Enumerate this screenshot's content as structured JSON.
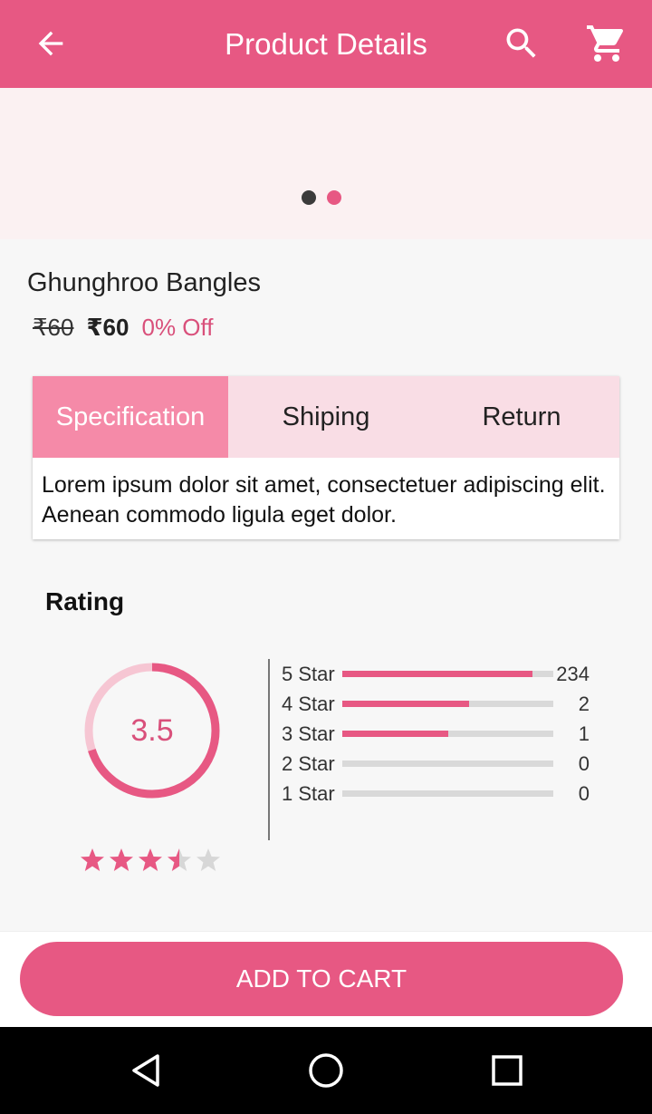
{
  "appbar": {
    "title": "Product Details",
    "back_icon": "arrow-left-icon",
    "search_icon": "search-icon",
    "cart_icon": "shopping-cart-icon",
    "color": "#e75883"
  },
  "carousel": {
    "page_count": 2,
    "active_index": 1
  },
  "product": {
    "name": "Ghunghroo Bangles",
    "mrp": "₹60",
    "price": "₹60",
    "discount": "0% Off"
  },
  "tabs": {
    "items": [
      {
        "label": "Specification",
        "active": true
      },
      {
        "label": "Shiping",
        "active": false
      },
      {
        "label": "Return",
        "active": false
      }
    ],
    "content": "Lorem ipsum dolor sit amet, consectetuer adipiscing elit. Aenean commodo ligula eget dolor."
  },
  "rating": {
    "heading": "Rating",
    "average": "3.5",
    "average_fraction": 0.7,
    "stars_value": 3.5,
    "stars_max": 5,
    "breakdown": [
      {
        "label": "5 Star",
        "count": "234",
        "fill": 0.9
      },
      {
        "label": "4 Star",
        "count": "2",
        "fill": 0.6
      },
      {
        "label": "3 Star",
        "count": "1",
        "fill": 0.5
      },
      {
        "label": "2 Star",
        "count": "0",
        "fill": 0
      },
      {
        "label": "1 Star",
        "count": "0",
        "fill": 0
      }
    ]
  },
  "cta": {
    "label": "ADD TO CART"
  },
  "system_nav": {
    "back_icon": "nav-back-icon",
    "home_icon": "nav-home-icon",
    "recent_icon": "nav-recents-icon"
  }
}
